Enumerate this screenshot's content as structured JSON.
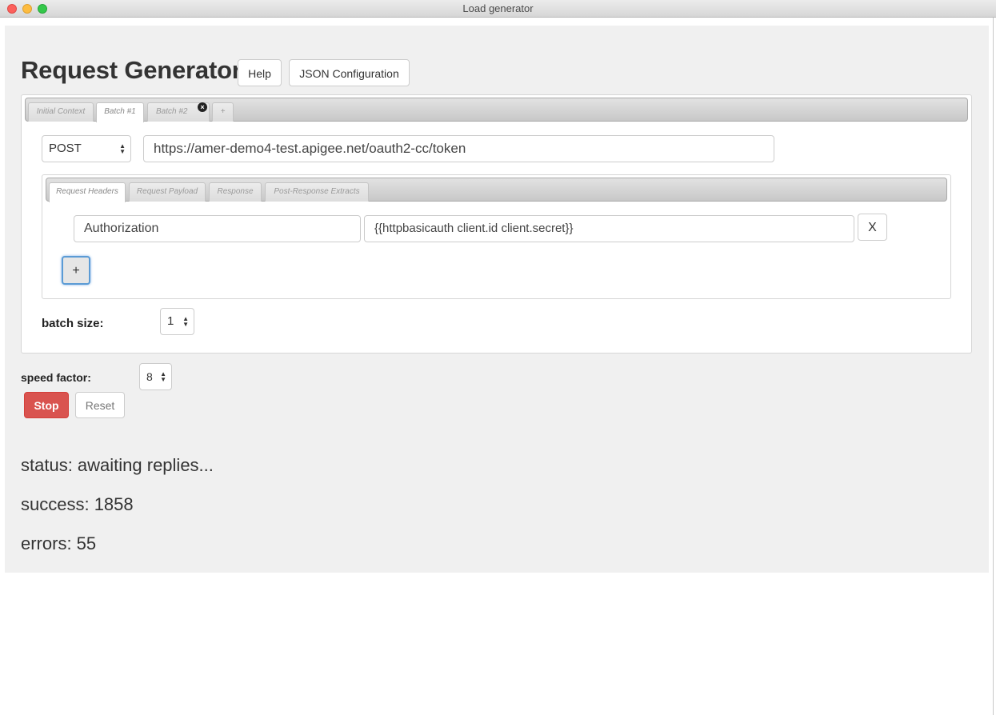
{
  "window": {
    "title": "Load generator"
  },
  "header": {
    "title": "Request Generator",
    "help_label": "Help",
    "json_label": "JSON Configuration"
  },
  "batch_tabs": [
    {
      "label": "Initial Context",
      "active": false
    },
    {
      "label": "Batch #1",
      "active": true
    },
    {
      "label": "Batch #2",
      "active": false,
      "closable": true
    },
    {
      "label": "+",
      "active": false
    }
  ],
  "request": {
    "method": "POST",
    "url": "https://amer-demo4-test.apigee.net/oauth2-cc/token"
  },
  "request_tabs": [
    {
      "label": "Request Headers",
      "active": true
    },
    {
      "label": "Request Payload",
      "active": false
    },
    {
      "label": "Response",
      "active": false
    },
    {
      "label": "Post-Response Extracts",
      "active": false
    }
  ],
  "headers": [
    {
      "name": "Authorization",
      "value": "{{httpbasicauth client.id client.secret}}",
      "remove_label": "X"
    }
  ],
  "add_header_label": "+",
  "batch_size": {
    "label": "batch size:",
    "value": "1"
  },
  "speed_factor": {
    "label": "speed factor:",
    "value": "8"
  },
  "controls": {
    "stop_label": "Stop",
    "reset_label": "Reset"
  },
  "stats": {
    "status": "status: awaiting replies...",
    "success": "success: 1858",
    "errors": "errors: 55"
  },
  "colors": {
    "stop": "#d9534f",
    "focus": "#5b9bd5"
  },
  "close_icon_glyph": "×"
}
